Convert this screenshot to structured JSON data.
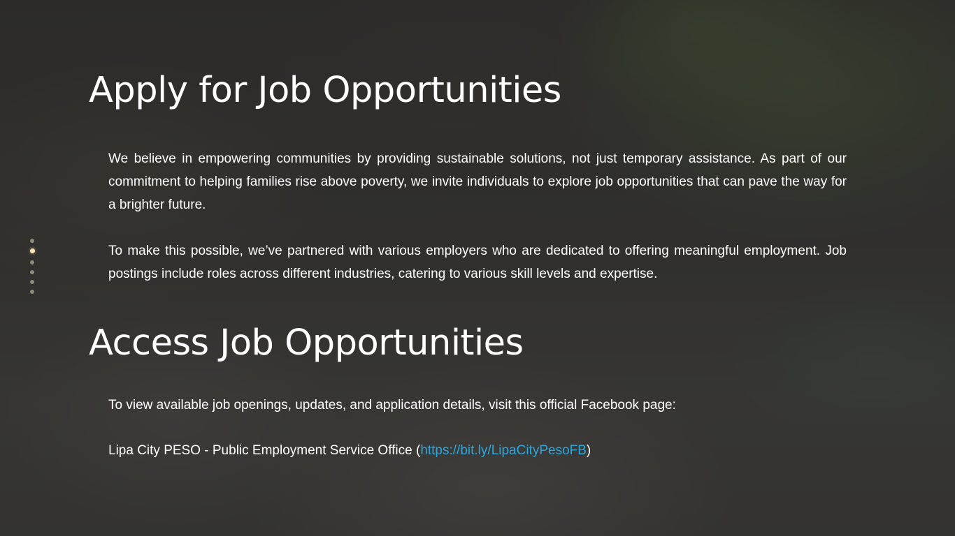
{
  "sections": {
    "apply": {
      "heading": "Apply for Job Opportunities",
      "paragraph1": "We believe in empowering communities by providing sustainable solutions, not just temporary assistance. As part of our commitment to helping families rise above poverty, we invite individuals to explore job opportunities that can pave the way for a brighter future.",
      "paragraph2": "To make this possible, we’ve partnered with various employers who are dedicated to offering meaningful employment. Job postings include roles across different industries, catering to various skill levels and expertise."
    },
    "access": {
      "heading": "Access Job Opportunities",
      "intro": "To view available job openings, updates, and application details, visit this official Facebook page:",
      "office_label": "Lipa City PESO - Public Employment Service Office (",
      "link_text": "https://bit.ly/LipaCityPesoFB",
      "closing_paren": ")"
    }
  },
  "navigation_dots": {
    "count": 6,
    "active_index": 1
  },
  "colors": {
    "text": "#ffffff",
    "link": "#29a8e0",
    "dot_active": "#f3e4b3",
    "dot_inactive": "#8f8a78"
  }
}
